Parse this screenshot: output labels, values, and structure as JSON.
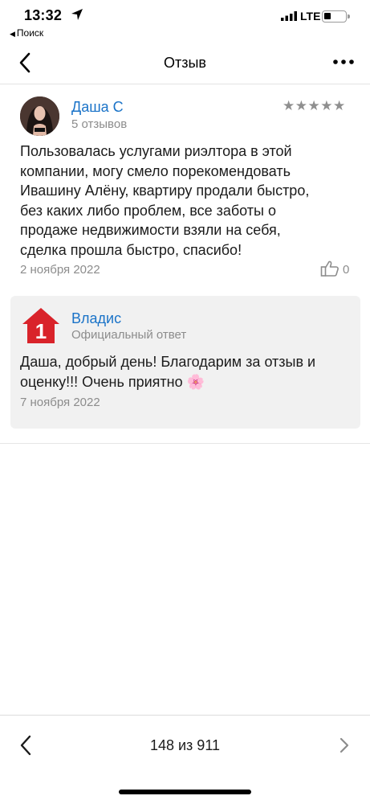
{
  "status_bar": {
    "time": "13:32",
    "back_app_label": "Поиск",
    "network": "LTE",
    "icons": [
      "location-arrow-icon",
      "signal-bars-icon",
      "battery-icon"
    ]
  },
  "nav": {
    "title": "Отзыв",
    "icons": [
      "back-chevron-icon",
      "more-dots-icon"
    ]
  },
  "review": {
    "author": "Даша С",
    "review_count": "5 отзывов",
    "stars": "★★★★★",
    "rating": 5,
    "text": "Пользовалась услугами риэлтора в этой\nкомпании, могу смело порекомендовать\nИвашину Алёну, квартиру продали быстро,\nбез каких либо проблем, все заботы о\nпродаже недвижимости взяли на себя,\nсделка прошла быстро, спасибо!",
    "date": "2 ноября 2022",
    "likes": "0"
  },
  "official_answer": {
    "company": "Владис",
    "label": "Официальный ответ",
    "logo_digit": "1",
    "text": "Даша, добрый день! Благодарим за отзыв и\nоценку!!! Очень приятно 🌸",
    "date": "7 ноября 2022"
  },
  "pager": {
    "label": "148 из 911"
  },
  "colors": {
    "link": "#1a73c8",
    "secondary_text": "#8c8c8c",
    "card_bg": "#f1f1f1",
    "logo_red": "#d9232a"
  }
}
